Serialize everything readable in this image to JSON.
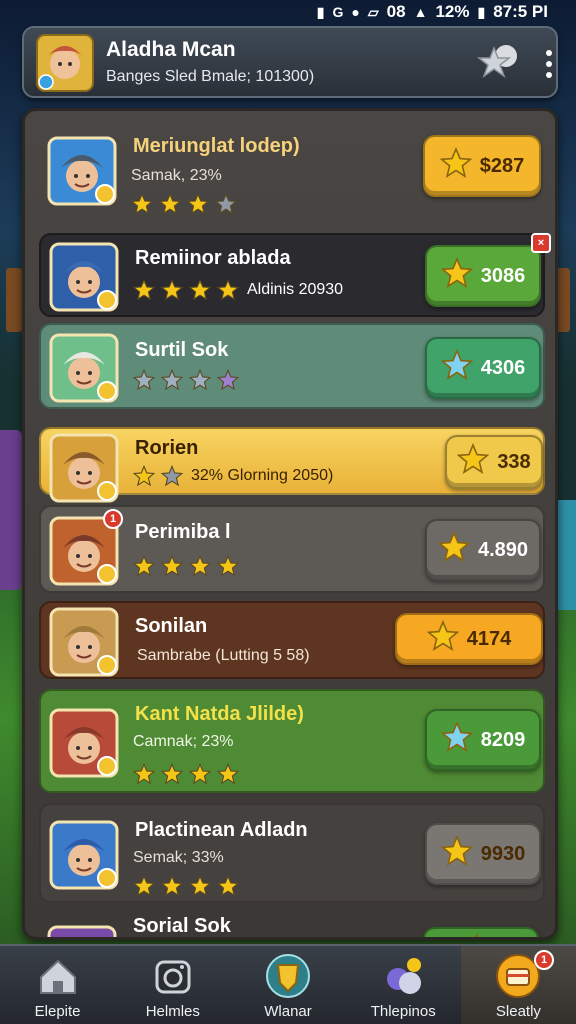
{
  "status_bar": {
    "icons": [
      "notification-icon",
      "g-icon",
      "location-icon",
      "signal-icon",
      "wifi-icon"
    ],
    "text": "08",
    "battery": "12%",
    "time": "87:5 PI"
  },
  "header": {
    "title": "Aladha Mcan",
    "subtitle": "Banges Sled Bmale; 101300)",
    "avatar_icon": "player-avatar-icon",
    "favorite_icon": "star-favorite-icon",
    "menu_icon": "more-vertical-icon"
  },
  "rows": [
    {
      "name": "Meriunglat lodep)",
      "meta_text": "Samak, 23%",
      "stars": 3,
      "star_style": "gold",
      "button": "$287",
      "button_color": "#f4b62b",
      "badge": "",
      "bg": "#4a4644"
    },
    {
      "name": "Remiinor ablada",
      "meta_text": "Aldinis 20930",
      "stars": 4,
      "star_style": "gold",
      "button": "3086",
      "button_color": "#5aa83a",
      "badge": "x",
      "bg": "#2b2a2f"
    },
    {
      "name": "Surtil Sok",
      "meta_text": "",
      "stars": 3,
      "star_style": "silver",
      "button": "4306",
      "button_color": "#3fa36a",
      "badge": "",
      "bg": "#5f8c78"
    },
    {
      "name": "Rorien",
      "meta_text": "32% Glorning 2050)",
      "stars": 1,
      "star_style": "gold",
      "button": "338",
      "button_color": "#f0c84a",
      "badge": "",
      "bg": "#f3c649"
    },
    {
      "name": "Perimiba l",
      "meta_text": "",
      "stars": 4,
      "star_style": "gold",
      "button": "4.890",
      "button_color": "#6d6a66",
      "badge": "1",
      "bg": "#5d5955"
    },
    {
      "name": "Sonilan",
      "meta_text": "Sambrabe (Lutting 5 58)",
      "stars": 0,
      "star_style": "gold",
      "button": "4174",
      "button_color": "#f6a823",
      "badge": "",
      "bg": "#5e3520"
    },
    {
      "name": "Kant Natda Jlilde)",
      "meta_text": "Camnak; 23%",
      "stars": 4,
      "star_style": "gold",
      "button": "8209",
      "button_color": "#4a9a3a",
      "badge": "",
      "bg": "#4f8a34"
    },
    {
      "name": "Plactinean Adladn",
      "meta_text": "Semak; 33%",
      "stars": 4,
      "star_style": "gold",
      "button": "9930",
      "button_color": "#7a7772",
      "badge": "",
      "bg": "#4d4947"
    },
    {
      "name": "Sorial Sok",
      "meta_text": "",
      "stars": 0,
      "star_style": "gold",
      "button": "",
      "button_color": "#4a9a3a",
      "badge": "",
      "bg": "#4d4947"
    }
  ],
  "nav": [
    {
      "label": "Elepite",
      "icon": "home-icon",
      "badge": ""
    },
    {
      "label": "Helmles",
      "icon": "camera-icon",
      "badge": ""
    },
    {
      "label": "Wlanar",
      "icon": "shield-icon",
      "badge": ""
    },
    {
      "label": "Thlepinos",
      "icon": "orbs-icon",
      "badge": ""
    },
    {
      "label": "Sleatly",
      "icon": "chest-icon",
      "badge": "1"
    }
  ],
  "colors": {
    "gold": "#f5c518",
    "accent_green": "#4a9a3a",
    "accent_orange": "#f6a823"
  }
}
